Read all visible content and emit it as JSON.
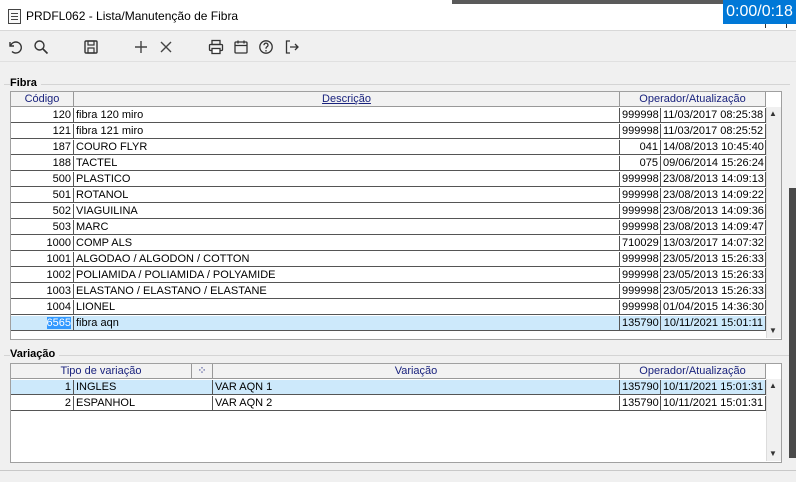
{
  "window": {
    "title": "PRDFL062 - Lista/Manutenção de Fibra",
    "timer": "0:00/0:18"
  },
  "toolbar": {
    "icons": [
      "undo-icon",
      "search-icon",
      "save-icon",
      "add-icon",
      "close-icon",
      "print-icon",
      "calendar-icon",
      "help-icon",
      "exit-icon"
    ]
  },
  "fibra": {
    "label": "Fibra",
    "headers": {
      "codigo": "Código",
      "descricao": "Descrição",
      "operador": "Operador/Atualização"
    },
    "rows": [
      {
        "codigo": "120",
        "descricao": "fibra 120 miro",
        "operador": "999998",
        "data": "11/03/2017 08:25:38"
      },
      {
        "codigo": "121",
        "descricao": "fibra 121 miro",
        "operador": "999998",
        "data": "11/03/2017 08:25:52"
      },
      {
        "codigo": "187",
        "descricao": "COURO FLYR",
        "operador": "041",
        "data": "14/08/2013 10:45:40"
      },
      {
        "codigo": "188",
        "descricao": "TACTEL",
        "operador": "075",
        "data": "09/06/2014 15:26:24"
      },
      {
        "codigo": "500",
        "descricao": "PLASTICO",
        "operador": "999998",
        "data": "23/08/2013 14:09:13"
      },
      {
        "codigo": "501",
        "descricao": "ROTANOL",
        "operador": "999998",
        "data": "23/08/2013 14:09:22"
      },
      {
        "codigo": "502",
        "descricao": "VIAGUILINA",
        "operador": "999998",
        "data": "23/08/2013 14:09:36"
      },
      {
        "codigo": "503",
        "descricao": "MARC",
        "operador": "999998",
        "data": "23/08/2013 14:09:47"
      },
      {
        "codigo": "1000",
        "descricao": "COMP ALS",
        "operador": "710029",
        "data": "13/03/2017 14:07:32"
      },
      {
        "codigo": "1001",
        "descricao": "ALGODAO / ALGODON / COTTON",
        "operador": "999998",
        "data": "23/05/2013 15:26:33"
      },
      {
        "codigo": "1002",
        "descricao": "POLIAMIDA / POLIAMIDA / POLYAMIDE",
        "operador": "999998",
        "data": "23/05/2013 15:26:33"
      },
      {
        "codigo": "1003",
        "descricao": "ELASTANO / ELASTANO / ELASTANE",
        "operador": "999998",
        "data": "23/05/2013 15:26:33"
      },
      {
        "codigo": "1004",
        "descricao": "LIONEL",
        "operador": "999998",
        "data": "01/04/2015 14:36:30"
      },
      {
        "codigo": "6565",
        "descricao": "fibra aqn",
        "operador": "135790",
        "data": "10/11/2021 15:01:11",
        "selected": true
      }
    ]
  },
  "variacao": {
    "label": "Variação",
    "headers": {
      "tipo": "Tipo de variação",
      "variacao": "Variação",
      "operador": "Operador/Atualização"
    },
    "rows": [
      {
        "num": "1",
        "tipo": "INGLES",
        "variacao": "VAR AQN 1",
        "operador": "135790",
        "data": "10/11/2021 15:01:31",
        "selected": true
      },
      {
        "num": "2",
        "tipo": "ESPANHOL",
        "variacao": "VAR AQN 2",
        "operador": "135790",
        "data": "10/11/2021 15:01:31"
      }
    ]
  },
  "colors": {
    "accent": "#0078d7",
    "selection": "#cde9fb",
    "header_text": "#1a237e",
    "selected_code": "#3399ff"
  }
}
